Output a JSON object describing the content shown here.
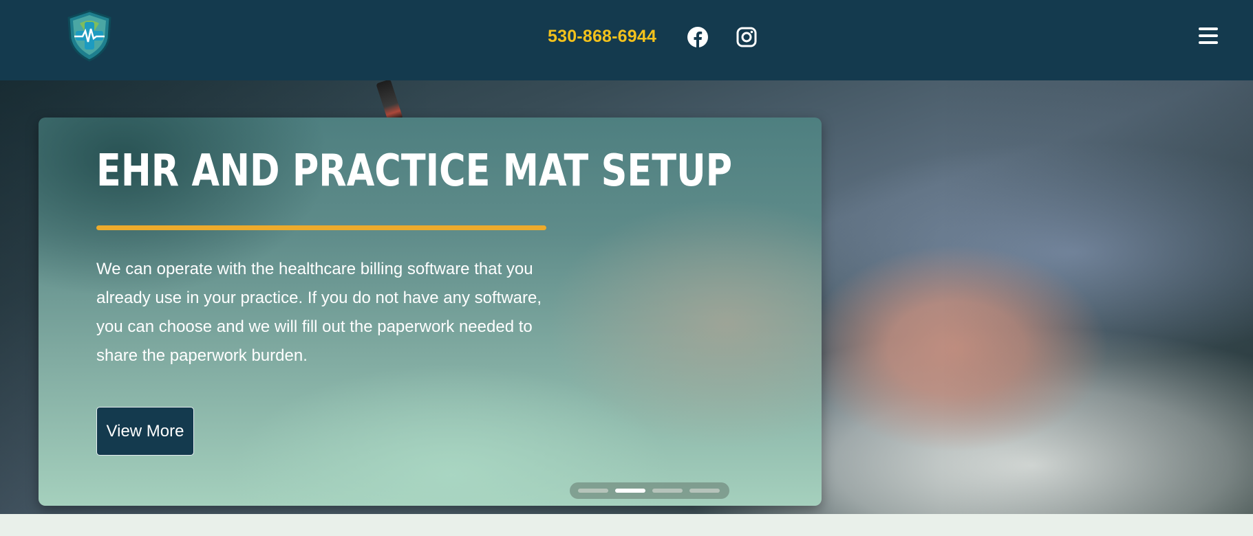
{
  "header": {
    "logo": {
      "icon": "medical-shield-logo-icon"
    },
    "phone": "530-868-6944",
    "social": [
      {
        "name": "Facebook",
        "icon": "facebook-icon"
      },
      {
        "name": "Instagram",
        "icon": "instagram-icon"
      }
    ],
    "menu_icon": "hamburger-menu-icon"
  },
  "hero": {
    "title": "EHR AND PRACTICE MAT SETUP",
    "description": "We can operate with the healthcare billing software that you already use in your practice. If you do not have any software, you can choose and we will fill out the paperwork needed to share the paperwork burden.",
    "button_label": "View More",
    "slides_total": 4,
    "active_slide": 2
  },
  "colors": {
    "header_bg": "#143a4e",
    "accent_yellow": "#f3c21c",
    "rule_orange": "#eeab2c",
    "button_bg": "#143a4e"
  }
}
